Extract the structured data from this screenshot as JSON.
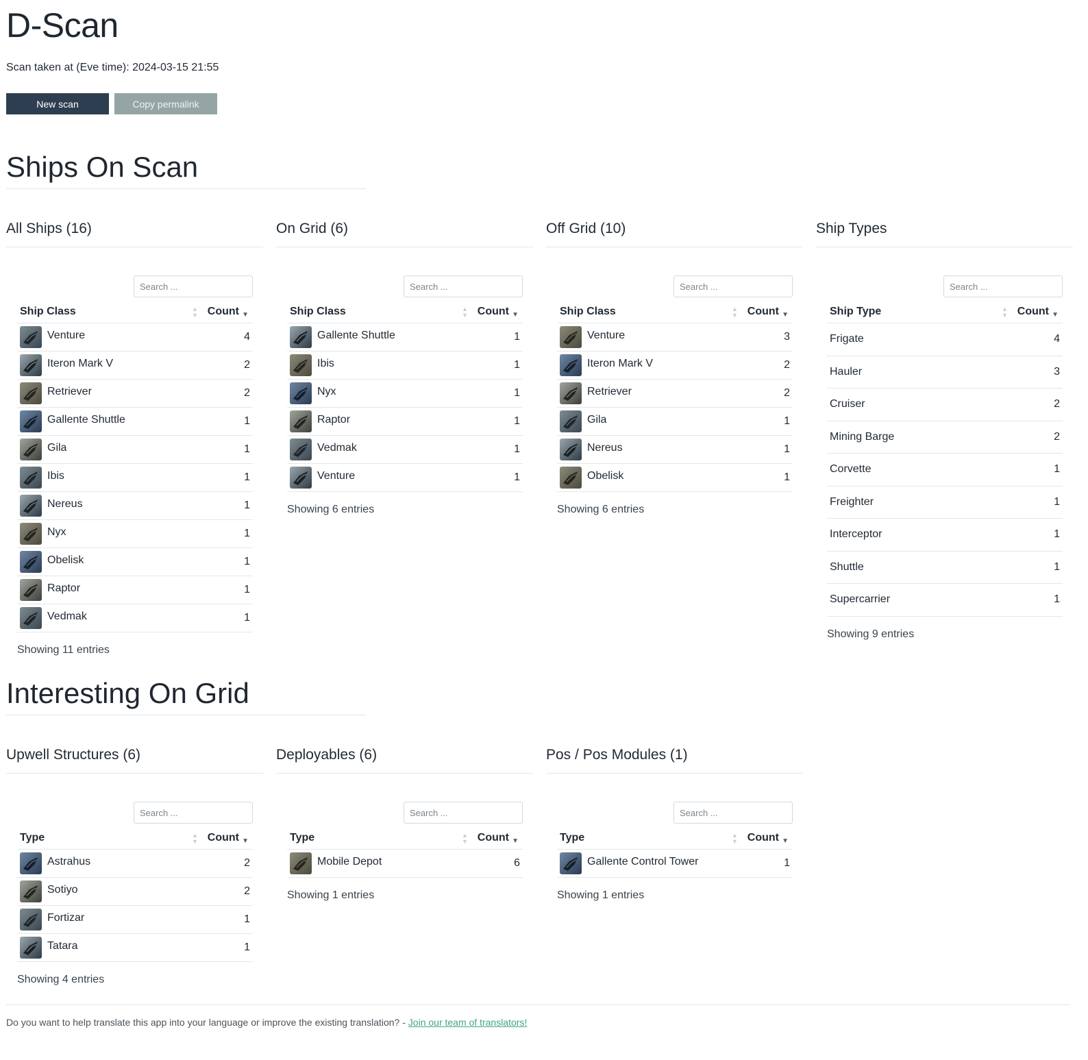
{
  "header": {
    "title": "D-Scan",
    "scan_time": "Scan taken at (Eve time): 2024-03-15 21:55",
    "new_scan_label": "New scan",
    "copy_permalink_label": "Copy permalink"
  },
  "search_placeholder": "Search ...",
  "ships_section": {
    "title": "Ships On Scan",
    "panels": [
      {
        "title": "All Ships (16)",
        "col_name": "Ship Class",
        "col_count": "Count",
        "rows": [
          {
            "name": "Venture",
            "count": "4",
            "icon": "ship-thumbnail-icon"
          },
          {
            "name": "Iteron Mark V",
            "count": "2",
            "icon": "ship-thumbnail-icon"
          },
          {
            "name": "Retriever",
            "count": "2",
            "icon": "ship-thumbnail-icon"
          },
          {
            "name": "Gallente Shuttle",
            "count": "1",
            "icon": "ship-thumbnail-icon"
          },
          {
            "name": "Gila",
            "count": "1",
            "icon": "ship-thumbnail-icon"
          },
          {
            "name": "Ibis",
            "count": "1",
            "icon": "ship-thumbnail-icon"
          },
          {
            "name": "Nereus",
            "count": "1",
            "icon": "ship-thumbnail-icon"
          },
          {
            "name": "Nyx",
            "count": "1",
            "icon": "ship-thumbnail-icon"
          },
          {
            "name": "Obelisk",
            "count": "1",
            "icon": "ship-thumbnail-icon"
          },
          {
            "name": "Raptor",
            "count": "1",
            "icon": "ship-thumbnail-icon"
          },
          {
            "name": "Vedmak",
            "count": "1",
            "icon": "ship-thumbnail-icon"
          }
        ],
        "showing": "Showing 11 entries"
      },
      {
        "title": "On Grid (6)",
        "col_name": "Ship Class",
        "col_count": "Count",
        "rows": [
          {
            "name": "Gallente Shuttle",
            "count": "1",
            "icon": "ship-thumbnail-icon"
          },
          {
            "name": "Ibis",
            "count": "1",
            "icon": "ship-thumbnail-icon"
          },
          {
            "name": "Nyx",
            "count": "1",
            "icon": "ship-thumbnail-icon"
          },
          {
            "name": "Raptor",
            "count": "1",
            "icon": "ship-thumbnail-icon"
          },
          {
            "name": "Vedmak",
            "count": "1",
            "icon": "ship-thumbnail-icon"
          },
          {
            "name": "Venture",
            "count": "1",
            "icon": "ship-thumbnail-icon"
          }
        ],
        "showing": "Showing 6 entries"
      },
      {
        "title": "Off Grid (10)",
        "col_name": "Ship Class",
        "col_count": "Count",
        "rows": [
          {
            "name": "Venture",
            "count": "3",
            "icon": "ship-thumbnail-icon"
          },
          {
            "name": "Iteron Mark V",
            "count": "2",
            "icon": "ship-thumbnail-icon"
          },
          {
            "name": "Retriever",
            "count": "2",
            "icon": "ship-thumbnail-icon"
          },
          {
            "name": "Gila",
            "count": "1",
            "icon": "ship-thumbnail-icon"
          },
          {
            "name": "Nereus",
            "count": "1",
            "icon": "ship-thumbnail-icon"
          },
          {
            "name": "Obelisk",
            "count": "1",
            "icon": "ship-thumbnail-icon"
          }
        ],
        "showing": "Showing 6 entries"
      },
      {
        "title": "Ship Types",
        "col_name": "Ship Type",
        "col_count": "Count",
        "rows": [
          {
            "name": "Frigate",
            "count": "4"
          },
          {
            "name": "Hauler",
            "count": "3"
          },
          {
            "name": "Cruiser",
            "count": "2"
          },
          {
            "name": "Mining Barge",
            "count": "2"
          },
          {
            "name": "Corvette",
            "count": "1"
          },
          {
            "name": "Freighter",
            "count": "1"
          },
          {
            "name": "Interceptor",
            "count": "1"
          },
          {
            "name": "Shuttle",
            "count": "1"
          },
          {
            "name": "Supercarrier",
            "count": "1"
          }
        ],
        "showing": "Showing 9 entries"
      }
    ]
  },
  "grid_section": {
    "title": "Interesting On Grid",
    "panels": [
      {
        "title": "Upwell Structures (6)",
        "col_name": "Type",
        "col_count": "Count",
        "rows": [
          {
            "name": "Astrahus",
            "count": "2",
            "icon": "structure-thumbnail-icon"
          },
          {
            "name": "Sotiyo",
            "count": "2",
            "icon": "structure-thumbnail-icon"
          },
          {
            "name": "Fortizar",
            "count": "1",
            "icon": "structure-thumbnail-icon"
          },
          {
            "name": "Tatara",
            "count": "1",
            "icon": "structure-thumbnail-icon"
          }
        ],
        "showing": "Showing 4 entries"
      },
      {
        "title": "Deployables (6)",
        "col_name": "Type",
        "col_count": "Count",
        "rows": [
          {
            "name": "Mobile Depot",
            "count": "6",
            "icon": "deployable-thumbnail-icon"
          }
        ],
        "showing": "Showing 1 entries"
      },
      {
        "title": "Pos / Pos Modules (1)",
        "col_name": "Type",
        "col_count": "Count",
        "rows": [
          {
            "name": "Gallente Control Tower",
            "count": "1",
            "icon": "tower-thumbnail-icon"
          }
        ],
        "showing": "Showing 1 entries"
      }
    ]
  },
  "footer": {
    "text": "Do you want to help translate this app into your language or improve the existing translation? - ",
    "link_text": "Join our team of translators!"
  },
  "colors": {
    "primary_button": "#2d3e50",
    "secondary_button": "#95a5a6",
    "link": "#3fa489"
  }
}
